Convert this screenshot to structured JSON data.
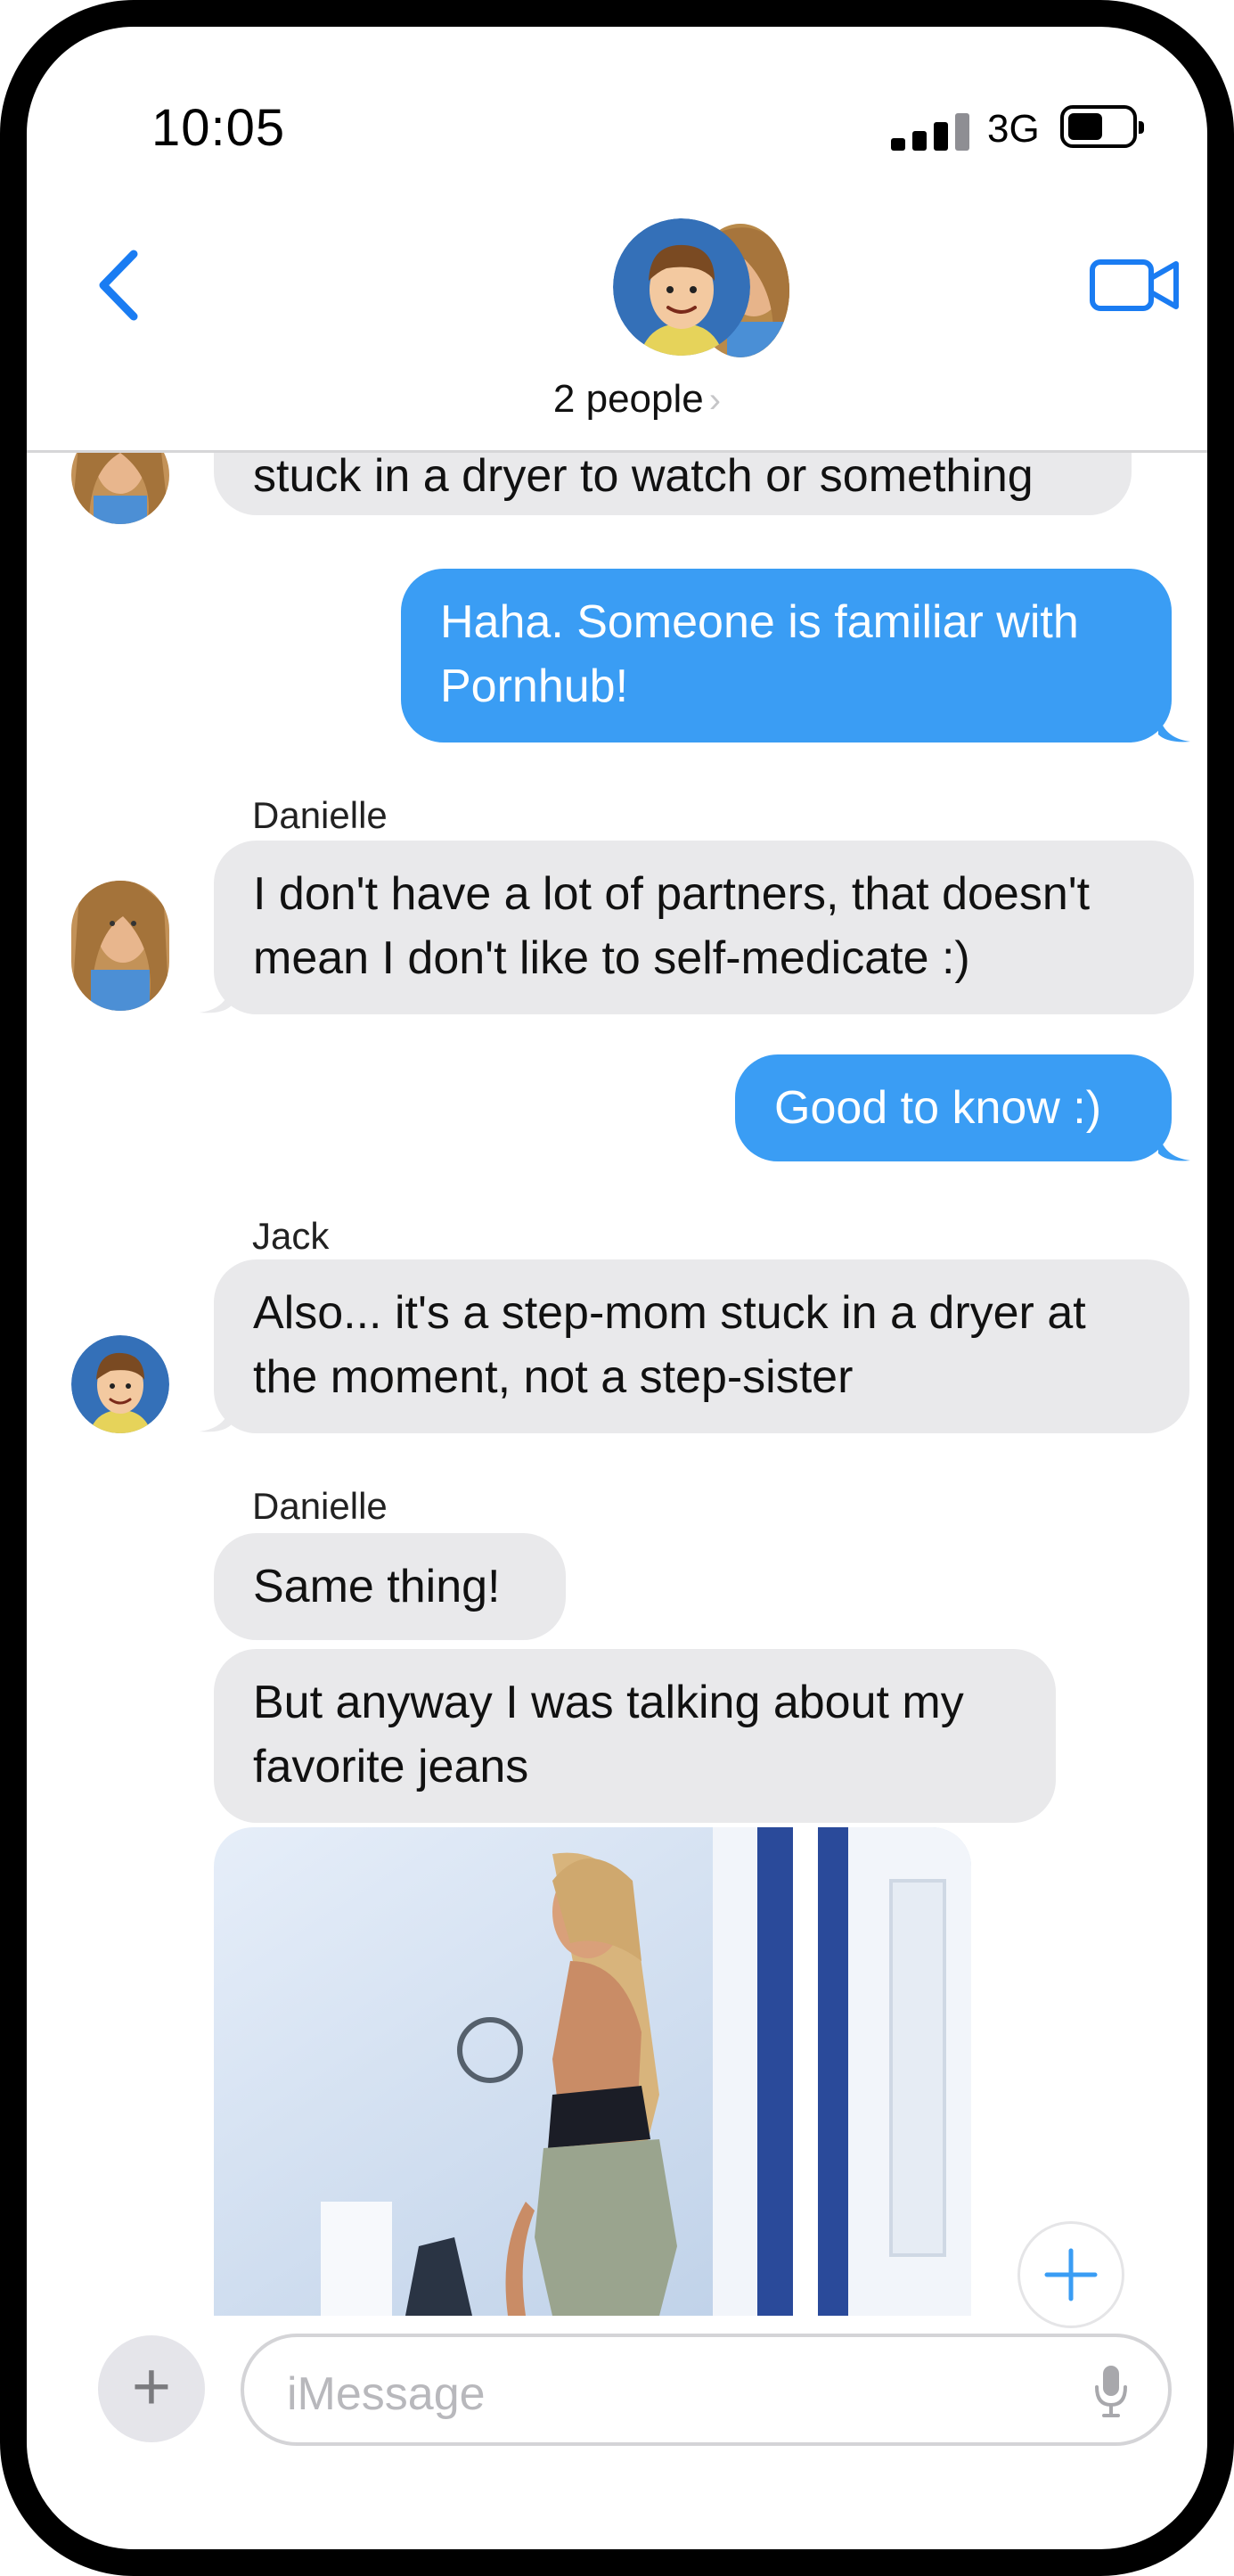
{
  "status_bar": {
    "time": "10:05",
    "network": "3G"
  },
  "header": {
    "group_label": "2 people",
    "chevron": "›",
    "back_icon": "chevron-left-icon",
    "video_icon": "video-camera-icon"
  },
  "colors": {
    "accent": "#1a7cf2",
    "bubble_blue": "#3a9df4",
    "bubble_gray": "#e9e9eb"
  },
  "messages": {
    "m0": {
      "text": "stuck in a dryer to watch or something"
    },
    "m1": {
      "text": "Haha.  Someone is familiar with Pornhub!"
    },
    "m2": {
      "sender": "Danielle",
      "text": "I don't have a lot of partners, that doesn't mean I don't like to self-medicate :)"
    },
    "m3": {
      "text": "Good to know :)"
    },
    "m4": {
      "sender": "Jack",
      "text": "Also... it's a step-mom stuck in a dryer at the moment, not a step-sister"
    },
    "m5": {
      "sender": "Danielle",
      "text": "Same thing!"
    },
    "m6": {
      "text": "But anyway I was talking about my favorite jeans"
    }
  },
  "input": {
    "placeholder": "iMessage",
    "plus_label": "+"
  }
}
